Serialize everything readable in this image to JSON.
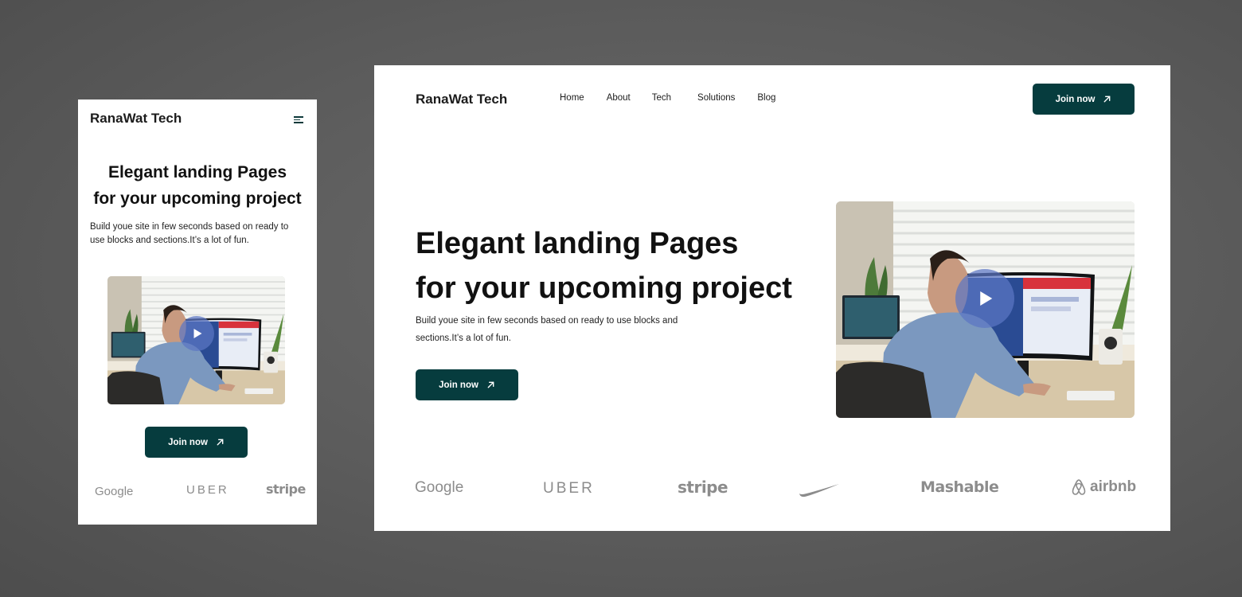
{
  "brand": "RanaWat Tech",
  "nav": [
    "Home",
    "About",
    "Tech",
    "Solutions",
    "Blog"
  ],
  "cta_label": "Join now",
  "hero": {
    "headline_line1": "Elegant landing Pages",
    "headline_line2": "for your upcoming project",
    "description": "Build youe site in few seconds based on ready to use blocks and sections.It’s a lot of fun."
  },
  "logos": {
    "google": "Google",
    "uber": "UBER",
    "stripe": "stripe",
    "mashable": "Mashable",
    "airbnb": "airbnb",
    "nike": "Nike"
  },
  "icons": {
    "menu": "hamburger-menu-icon",
    "arrow": "arrow-up-right-icon",
    "play": "play-icon",
    "nike": "nike-swoosh-icon",
    "airbnb": "airbnb-belo-icon"
  },
  "colors": {
    "button_bg": "#063c3e",
    "logo_gray": "#8c8c8c",
    "play_overlay": "#5c76c4"
  }
}
